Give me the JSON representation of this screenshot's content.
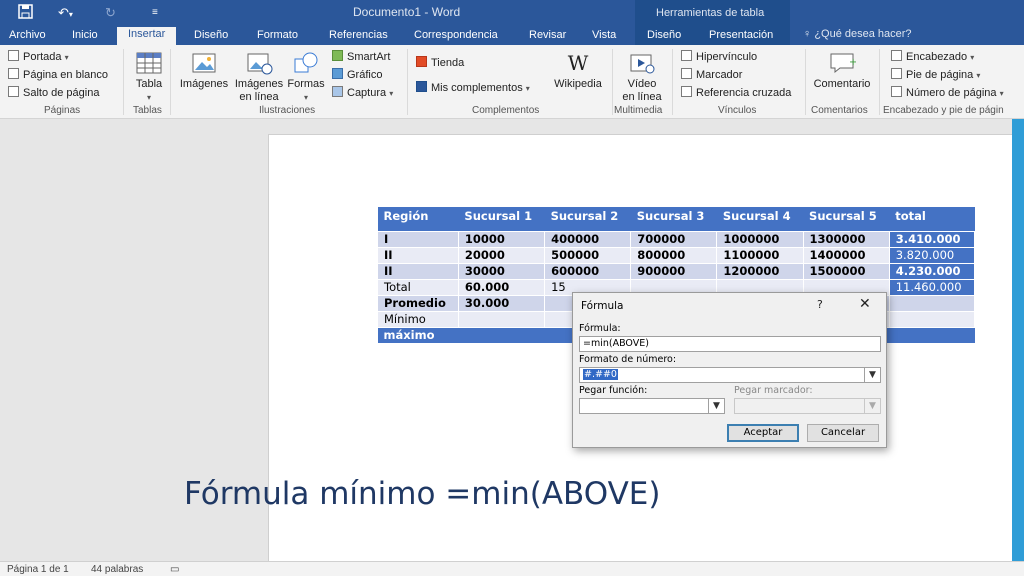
{
  "titlebar": {
    "doc_title": "Documento1 - Word",
    "contextual_header": "Herramientas de tabla",
    "accent": "#2b579a"
  },
  "tabs": {
    "items": [
      "Archivo",
      "Inicio",
      "Insertar",
      "Diseño",
      "Formato",
      "Referencias",
      "Correspondencia",
      "Revisar",
      "Vista",
      "Diseño",
      "Presentación"
    ],
    "active": "Insertar",
    "tell_me": "¿Qué desea hacer?"
  },
  "ribbon": {
    "paginas": {
      "portada": "Portada",
      "pagina_blanco": "Página en blanco",
      "salto": "Salto de página",
      "label": "Páginas"
    },
    "tablas": {
      "tabla": "Tabla",
      "label": "Tablas"
    },
    "ilustraciones": {
      "imagenes": "Imágenes",
      "imagenes_linea_1": "Imágenes",
      "imagenes_linea_2": "en línea",
      "formas": "Formas",
      "smartart": "SmartArt",
      "grafico": "Gráfico",
      "captura": "Captura",
      "label": "Ilustraciones"
    },
    "complementos": {
      "tienda": "Tienda",
      "mis": "Mis complementos",
      "wikipedia": "Wikipedia",
      "label": "Complementos"
    },
    "multimedia": {
      "video_1": "Vídeo",
      "video_2": "en línea",
      "label": "Multimedia"
    },
    "vinculos": {
      "hipervinculo": "Hipervínculo",
      "marcador": "Marcador",
      "referencia": "Referencia cruzada",
      "label": "Vínculos"
    },
    "comentarios": {
      "comentario": "Comentario",
      "label": "Comentarios"
    },
    "encabezado": {
      "encabezado": "Encabezado",
      "pie": "Pie de página",
      "numero": "Número de página",
      "label": "Encabezado y pie de págin"
    }
  },
  "table": {
    "header": [
      "Región",
      "Sucursal 1",
      "Sucursal 2",
      "Sucursal 3",
      "Sucursal 4",
      "Sucursal 5",
      "total"
    ],
    "rows": [
      [
        "I",
        "10000",
        "400000",
        "700000",
        "1000000",
        "1300000",
        "3.410.000"
      ],
      [
        "II",
        "20000",
        "500000",
        "800000",
        "1100000",
        "1400000",
        "3.820.000"
      ],
      [
        "II",
        "30000",
        "600000",
        "900000",
        "1200000",
        "1500000",
        "4.230.000"
      ],
      [
        "Total",
        "60.000",
        "15",
        "",
        "",
        "",
        "11.460.000"
      ],
      [
        "Promedio",
        "30.000",
        "",
        "",
        "",
        "",
        ""
      ],
      [
        "Mínimo",
        "",
        "",
        "",
        "",
        "",
        ""
      ],
      [
        "máximo",
        "",
        "",
        "",
        "",
        "",
        ""
      ]
    ]
  },
  "dialog": {
    "title": "Fórmula",
    "help": "?",
    "close": "✕",
    "formula_label": "Fórmula:",
    "formula_value": "=min(ABOVE)",
    "format_label": "Formato de número:",
    "format_value": "#.##0",
    "pegar_funcion_label": "Pegar función:",
    "pegar_marcador_label": "Pegar marcador:",
    "accept": "Aceptar",
    "cancel": "Cancelar"
  },
  "caption": "Fórmula mínimo  =min(ABOVE)",
  "status": {
    "page": "Página 1 de 1",
    "words": "44 palabras"
  }
}
